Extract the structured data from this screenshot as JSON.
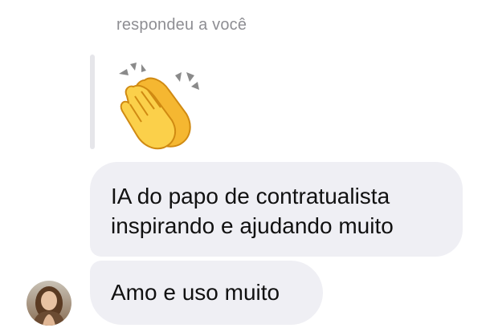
{
  "reply": {
    "header": "respondeu a você",
    "quoted_emoji": "clapping-hands-emoji"
  },
  "messages": [
    {
      "lines": [
        "IA do papo de contratualista",
        "inspirando e ajudando muito"
      ]
    },
    {
      "lines": [
        "Amo e uso muito"
      ]
    }
  ],
  "colors": {
    "bubble": "#efeff4",
    "header_text": "#8e8e93",
    "quote_bar": "#e6e6ea",
    "emoji_yellow": "#f7c23f"
  }
}
